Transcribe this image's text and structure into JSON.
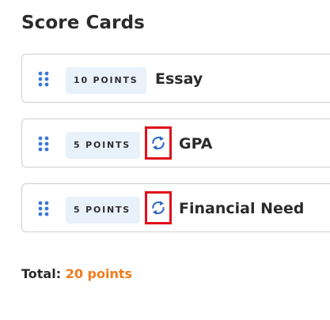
{
  "section": {
    "title": "Score Cards"
  },
  "cards": [
    {
      "points_label": "10 POINTS",
      "name": "Essay",
      "has_sync_icon": false
    },
    {
      "points_label": "5 POINTS",
      "name": "GPA",
      "has_sync_icon": true
    },
    {
      "points_label": "5 POINTS",
      "name": "Financial Need",
      "has_sync_icon": true
    }
  ],
  "total": {
    "label": "Total:",
    "value": "20 points"
  },
  "colors": {
    "drag_dots": "#3a78d6",
    "sync_icon": "#2b66c9",
    "highlight_box": "#e0101a",
    "total_value": "#f07b1a",
    "badge_bg": "#e9f1fa"
  },
  "icons": {
    "drag_handle": "drag-handle-icon",
    "sync": "sync-icon"
  }
}
